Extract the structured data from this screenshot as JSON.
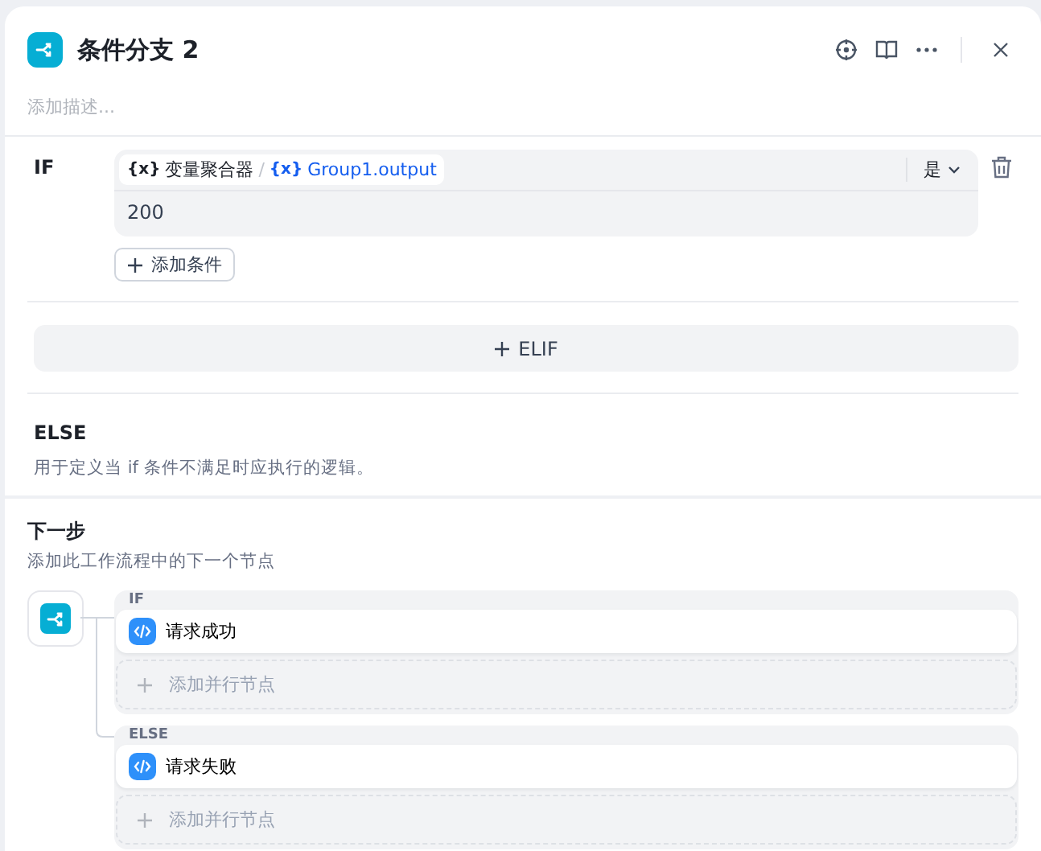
{
  "node": {
    "title": "条件分支 2",
    "description_placeholder": "添加描述..."
  },
  "cases": [
    {
      "label": "IF",
      "conditions": [
        {
          "source_icon": "{x}",
          "source": "变量聚合器",
          "separator": "/",
          "path_icon": "{x}",
          "path": "Group1.output",
          "operator": "是",
          "value": "200"
        }
      ],
      "add_condition": "添加条件"
    }
  ],
  "elif_button": "ELIF",
  "else": {
    "label": "ELSE",
    "description": "用于定义当 if 条件不满足时应执行的逻辑。"
  },
  "next_step": {
    "title": "下一步",
    "description": "添加此工作流程中的下一个节点",
    "branches": [
      {
        "label": "IF",
        "nodes": [
          {
            "name": "请求成功"
          }
        ],
        "add_parallel": "添加并行节点"
      },
      {
        "label": "ELSE",
        "nodes": [
          {
            "name": "请求失败"
          }
        ],
        "add_parallel": "添加并行节点"
      }
    ]
  }
}
